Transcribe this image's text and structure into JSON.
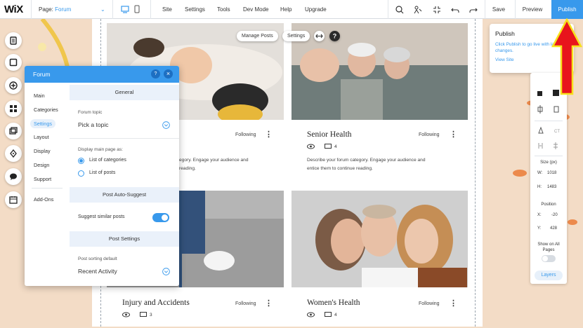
{
  "topbar": {
    "logo": "WiX",
    "page_label": "Page:",
    "page_value": "Forum",
    "menu": [
      "Site",
      "Settings",
      "Tools",
      "Dev Mode",
      "Help",
      "Upgrade"
    ],
    "save": "Save",
    "preview": "Preview",
    "publish": "Publish"
  },
  "canvas": {
    "pills": {
      "manage_posts": "Manage Posts",
      "settings": "Settings"
    },
    "posts": [
      {
        "title": "",
        "following": "Following",
        "views": "",
        "comments": "",
        "desc": "egory. Engage your audience and\nreading."
      },
      {
        "title": "Senior Health",
        "following": "Following",
        "views": "",
        "comments": "4",
        "desc": "Describe your forum category. Engage your audience and\nentice them to continue reading."
      },
      {
        "title": "Injury and Accidents",
        "following": "Following",
        "views": "",
        "comments": "3",
        "desc": ""
      },
      {
        "title": "Women's Health",
        "following": "Following",
        "views": "",
        "comments": "4",
        "desc": ""
      }
    ]
  },
  "left_toolbar": {
    "icons": [
      "pages-icon",
      "background-icon",
      "add-icon",
      "add-apps-icon",
      "media-icon",
      "blog-icon",
      "chat-icon",
      "bookings-icon"
    ]
  },
  "forum_panel": {
    "title": "Forum",
    "help": "?",
    "close": "×",
    "nav": [
      "Main",
      "Categories",
      "Settings",
      "Layout",
      "Display",
      "Design",
      "Support",
      "Add-Ons"
    ],
    "selected_nav": "Settings",
    "sections": {
      "general": "General",
      "forum_topic_label": "Forum topic",
      "forum_topic_value": "Pick a topic",
      "display_main_label": "Display main page as:",
      "display_options": [
        "List of categories",
        "List of posts"
      ],
      "auto_suggest": "Post Auto-Suggest",
      "suggest_label": "Suggest similar posts",
      "post_settings": "Post Settings",
      "sorting_label": "Post sorting default",
      "sorting_value": "Recent Activity"
    }
  },
  "publish_tooltip": {
    "title": "Publish",
    "desc": "Click Publish to go live with latest changes.",
    "link": "View Site"
  },
  "right_panel": {
    "size_label": "Size (px)",
    "w_label": "W:",
    "w_value": "1018",
    "h_label": "H:",
    "h_value": "1483",
    "position_label": "Position",
    "x_label": "X:",
    "x_value": "-20",
    "y_label": "Y:",
    "y_value": "428",
    "show_all": "Show on All Pages",
    "layers": "Layers"
  },
  "colors": {
    "accent": "#3899ec",
    "arrow": "#e8141c",
    "arrow_outline": "#f7e11c"
  }
}
